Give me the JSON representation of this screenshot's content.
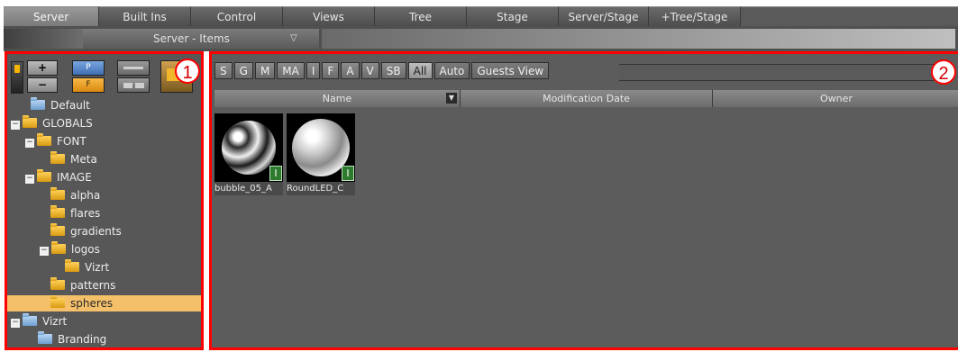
{
  "tabs": [
    {
      "label": "Server",
      "active": true
    },
    {
      "label": "Built Ins"
    },
    {
      "label": "Control"
    },
    {
      "label": "Views"
    },
    {
      "label": "Tree"
    },
    {
      "label": "Stage"
    },
    {
      "label": "Server/Stage"
    },
    {
      "label": "+Tree/Stage"
    }
  ],
  "subbar": {
    "selector_label": "Server - Items",
    "chevron": "▽"
  },
  "panel1": {
    "marker": "1",
    "toolbar": {
      "plus": "+",
      "minus": "−",
      "btn_p": "P",
      "btn_f": "F"
    },
    "tree": [
      {
        "label": "Default"
      },
      {
        "label": "GLOBALS"
      },
      {
        "label": "FONT"
      },
      {
        "label": "Meta"
      },
      {
        "label": "IMAGE"
      },
      {
        "label": "alpha"
      },
      {
        "label": "flares"
      },
      {
        "label": "gradients"
      },
      {
        "label": "logos"
      },
      {
        "label": "Vizrt"
      },
      {
        "label": "patterns"
      },
      {
        "label": "spheres"
      },
      {
        "label": "Vizrt"
      },
      {
        "label": "Branding"
      }
    ],
    "expander_symbol": "−"
  },
  "panel2": {
    "marker": "2",
    "filters": [
      "S",
      "G",
      "M",
      "MA",
      "I",
      "F",
      "A",
      "V",
      "SB",
      "All",
      "Auto",
      "Guests View"
    ],
    "active_filter": "All",
    "columns": [
      "Name",
      "Modification Date",
      "Owner"
    ],
    "items": [
      {
        "label": "bubble_05_A",
        "badge": "I"
      },
      {
        "label": "RoundLED_C",
        "badge": "I"
      }
    ]
  },
  "colors": {
    "highlight": "#ff0000",
    "selection": "#f5c06a",
    "folder": "#f2b62a"
  }
}
